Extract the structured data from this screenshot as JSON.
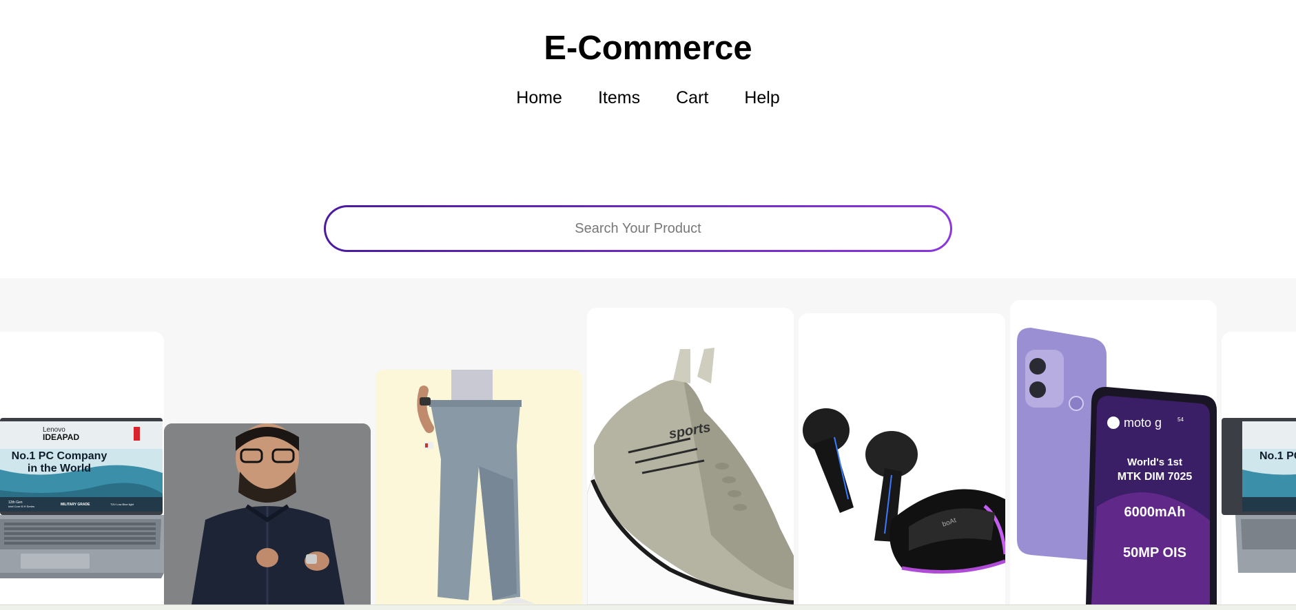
{
  "header": {
    "title": "E-Commerce",
    "nav": [
      "Home",
      "Items",
      "Cart",
      "Help"
    ]
  },
  "search": {
    "placeholder": "Search Your Product",
    "value": ""
  },
  "carousel": {
    "laptop": {
      "brand": "Lenovo",
      "model": "IDEAPAD",
      "headline_1": "No.1 PC Company",
      "headline_2": "in the World",
      "badge_1": "12th Gen",
      "badge_1b": "Intel Core i5 H Series",
      "badge_2": "MILITARY GRADE",
      "badge_3": "TÜV Low Blue light"
    },
    "earbuds": {
      "brand": "boAt"
    },
    "phone": {
      "brand": "moto g",
      "sup": "54",
      "line_1": "World's 1st",
      "line_2": "MTK DIM 7025",
      "line_3": "6000mAh",
      "line_4": "50MP OIS"
    },
    "shoe": {
      "brand": "sports"
    }
  },
  "colors": {
    "accent_start": "#4a1aa0",
    "accent_end": "#8a36e0",
    "phone_purple": "#9b8fd4"
  }
}
